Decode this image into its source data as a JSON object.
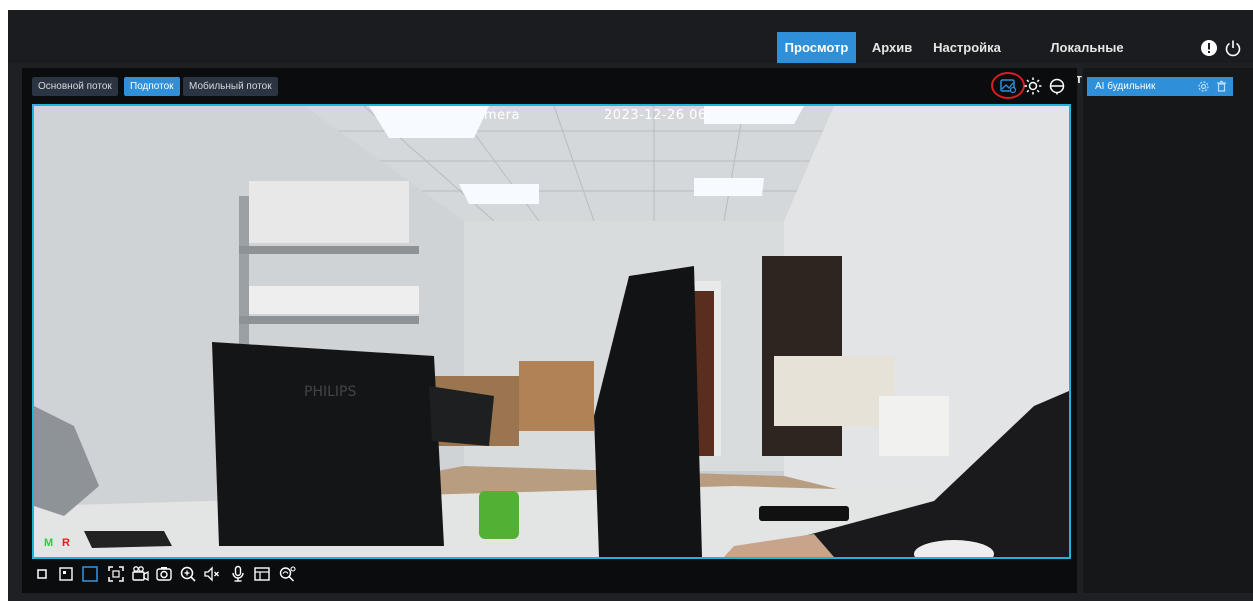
{
  "nav": {
    "tabs": [
      {
        "label": "Просмотр",
        "active": true
      },
      {
        "label": "Архив",
        "active": false
      },
      {
        "label": "Настройка",
        "active": false
      },
      {
        "label": "Локальные настройки",
        "active": false
      }
    ],
    "icons": [
      "alert-icon",
      "power-icon"
    ]
  },
  "streams": [
    {
      "label": "Основной поток",
      "active": false
    },
    {
      "label": "Подпоток",
      "active": true
    },
    {
      "label": "Мобильный поток",
      "active": false
    }
  ],
  "video": {
    "osd_name": "mera",
    "osd_datetime": "2023-12-26 06:",
    "monitor_brand": "PHILIPS",
    "indicator_m": "M",
    "indicator_r": "R"
  },
  "toolbar_right_icons": [
    "picture-settings-icon",
    "brightness-icon",
    "ptz-icon"
  ],
  "bottom_toolbar_icons": [
    "single-view-icon",
    "quad-view-icon",
    "fit-icon",
    "fullscreen-icon",
    "record-icon",
    "snapshot-icon",
    "zoom-icon",
    "mute-icon",
    "microphone-icon",
    "layout-icon",
    "ai-search-icon"
  ],
  "right_panel": {
    "alarm_label": "AI будильник",
    "icons": [
      "settings-icon",
      "delete-icon"
    ]
  },
  "colors": {
    "accent": "#2f8fd8",
    "video_border": "#1fb5d6",
    "highlight": "#d81e1e",
    "indicator_m": "#2ecc40",
    "indicator_r": "#e02020"
  }
}
